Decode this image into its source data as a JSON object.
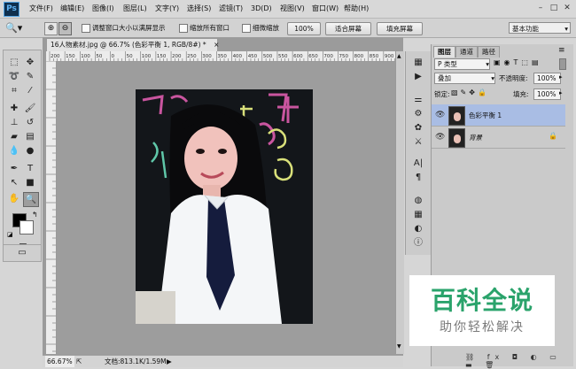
{
  "app": {
    "logo": "Ps"
  },
  "menu": [
    "文件(F)",
    "编辑(E)",
    "图像(I)",
    "图层(L)",
    "文字(Y)",
    "选择(S)",
    "滤镜(T)",
    "3D(D)",
    "视图(V)",
    "窗口(W)",
    "帮助(H)"
  ],
  "options": {
    "resize_label": "调整窗口大小以满屏显示",
    "zoom_all_label": "缩放所有窗口",
    "scrubby_label": "细微缩放",
    "percent_btn": "100%",
    "fit_btn": "适合屏幕",
    "fill_btn": "填充屏幕",
    "workspace": "基本功能"
  },
  "document": {
    "tab_title": "16人物素材.jpg @ 66.7% (色彩平衡 1, RGB/8#) *",
    "ruler_marks": [
      "200",
      "150",
      "100",
      "50",
      "0",
      "50",
      "100",
      "150",
      "200",
      "250",
      "300",
      "350",
      "400",
      "450",
      "500",
      "550",
      "600",
      "650",
      "700",
      "750",
      "800",
      "850",
      "900"
    ],
    "zoom": "66.67%",
    "doc_info": "文档:813.1K/1.59M"
  },
  "layers_panel": {
    "tabs": [
      "图层",
      "通道",
      "路径"
    ],
    "kind_filter": "P 类型",
    "blend_mode": "叠加",
    "opacity_label": "不透明度:",
    "opacity_value": "100%",
    "lock_label": "锁定:",
    "fill_label": "填充:",
    "fill_value": "100%",
    "layers": [
      {
        "name": "色彩平衡 1",
        "selected": true
      },
      {
        "name": "背景",
        "selected": false,
        "locked": true
      }
    ]
  },
  "watermark": {
    "title": "百科全说",
    "subtitle": "助你轻松解决"
  },
  "colors": {
    "accent_green": "#2aa36b",
    "selected_layer": "#a9bde4"
  }
}
